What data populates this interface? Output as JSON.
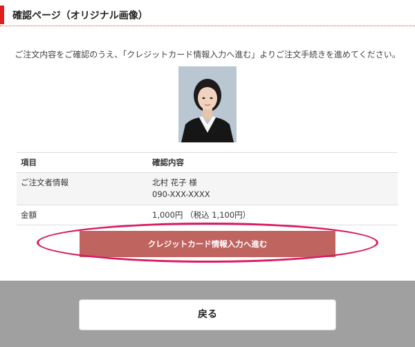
{
  "header": {
    "title": "確認ページ（オリジナル画像）"
  },
  "instruction": "ご注文内容をご確認のうえ、「クレジットカード情報入力へ進む」よりご注文手続きを進めてください。",
  "photo": {
    "alt": "証明写真"
  },
  "table": {
    "headers": [
      "項目",
      "確認内容"
    ],
    "rows": [
      {
        "label": "ご注文者情報",
        "lines": [
          "北村 花子 様",
          "090-XXX-XXXX"
        ]
      },
      {
        "label": "金額",
        "lines": [
          "1,000円 （税込 1,100円）"
        ]
      }
    ]
  },
  "buttons": {
    "proceed_label": "クレジットカード情報入力へ進む",
    "back_label": "戻る"
  },
  "colors": {
    "accent_red": "#e01e1e",
    "proceed_button": "#c0645f",
    "highlight_ellipse": "#d81b60",
    "footer_bg": "#a0a0a0"
  }
}
